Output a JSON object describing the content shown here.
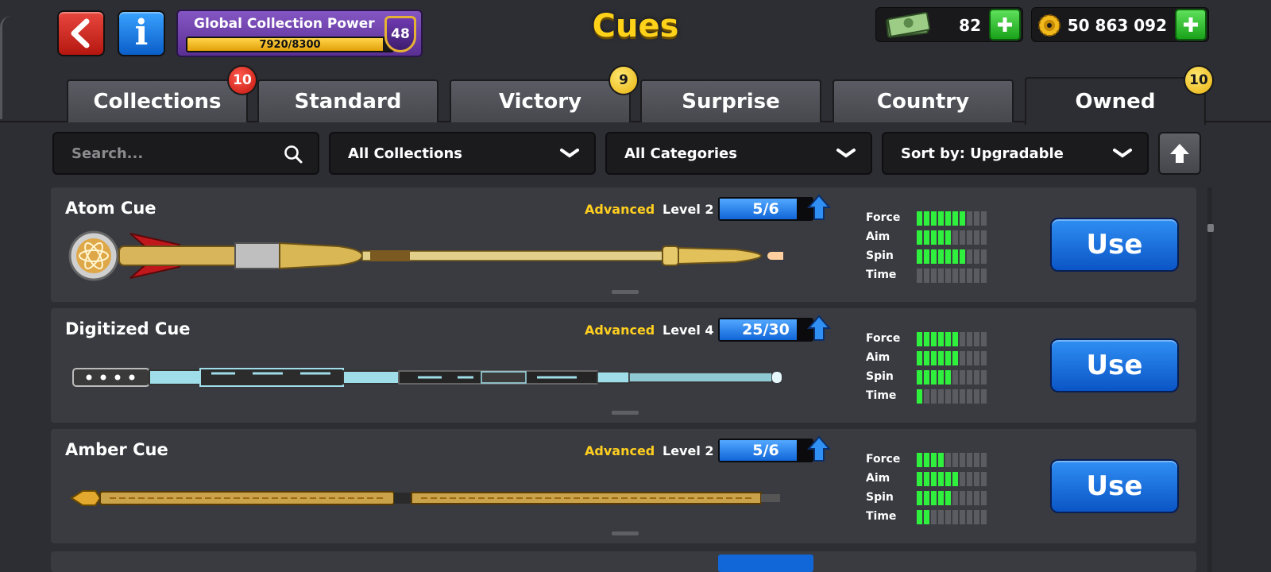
{
  "header": {
    "title": "Cues",
    "back_icon": "back-arrow-icon",
    "info_icon": "info-icon",
    "info_glyph": "i",
    "collection_power": {
      "label": "Global Collection Power",
      "progress_text": "7920/8300",
      "progress_fraction": 0.954,
      "level": "48"
    },
    "currencies": [
      {
        "icon": "cash-icon",
        "value": "82"
      },
      {
        "icon": "coins-icon",
        "value": "50 863 092"
      }
    ]
  },
  "tabs": [
    {
      "label": "Collections",
      "badge": "10",
      "badge_color": "#d01a12"
    },
    {
      "label": "Standard"
    },
    {
      "label": "Victory",
      "badge": "9",
      "badge_color": "#f0c21a"
    },
    {
      "label": "Surprise"
    },
    {
      "label": "Country"
    },
    {
      "label": "Owned",
      "badge": "10",
      "badge_color": "#f0c21a",
      "active": true
    }
  ],
  "filters": {
    "search_placeholder": "Search...",
    "collection": "All Collections",
    "category": "All Categories",
    "sort": "Sort by: Upgradable"
  },
  "stat_labels": {
    "force": "Force",
    "aim": "Aim",
    "spin": "Spin",
    "time": "Time"
  },
  "cues": [
    {
      "name": "Atom Cue",
      "tier": "Advanced",
      "level": "Level 2",
      "progress": "5/6",
      "progress_fraction": 0.833,
      "stats": {
        "force": 7,
        "aim": 5,
        "spin": 7,
        "time": 0
      },
      "use_label": "Use"
    },
    {
      "name": "Digitized Cue",
      "tier": "Advanced",
      "level": "Level 4",
      "progress": "25/30",
      "progress_fraction": 0.833,
      "stats": {
        "force": 6,
        "aim": 6,
        "spin": 5,
        "time": 1
      },
      "use_label": "Use"
    },
    {
      "name": "Amber Cue",
      "tier": "Advanced",
      "level": "Level 2",
      "progress": "5/6",
      "progress_fraction": 0.833,
      "stats": {
        "force": 4,
        "aim": 6,
        "spin": 5,
        "time": 2
      },
      "use_label": "Use"
    }
  ],
  "colors": {
    "accent_gold": "#ffcf1f",
    "stat_on": "#2ff03c",
    "use_blue": "#1a6fe0",
    "power_purple": "#6a3aa8"
  }
}
